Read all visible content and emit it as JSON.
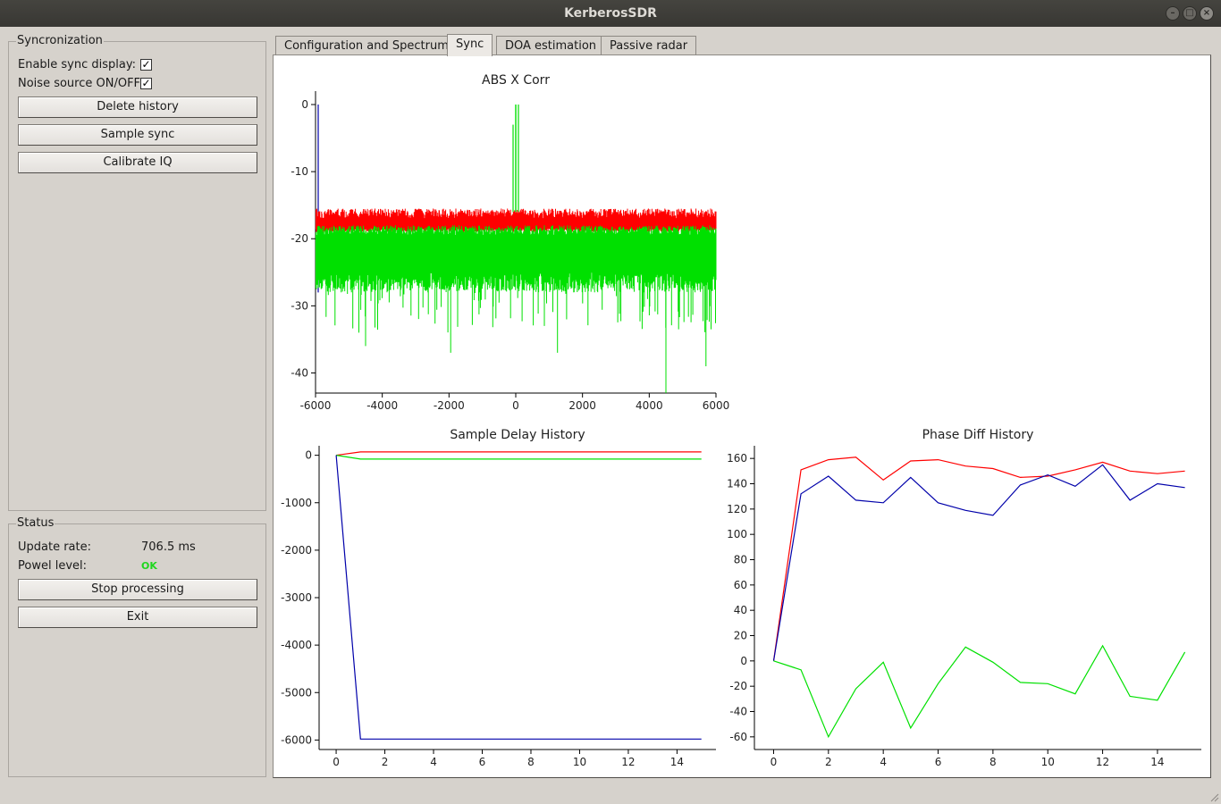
{
  "window": {
    "title": "KerberosSDR"
  },
  "sync_panel": {
    "title": "Syncronization",
    "enable_sync_display": {
      "label": "Enable sync display:",
      "checked": true
    },
    "noise_source": {
      "label": "Noise source ON/OFF",
      "checked": true
    },
    "delete_history_label": "Delete history",
    "sample_sync_label": "Sample sync",
    "calibrate_iq_label": "Calibrate IQ"
  },
  "status_panel": {
    "title": "Status",
    "update_rate_label": "Update rate:",
    "update_rate_value": "706.5 ms",
    "power_level_label": "Powel level:",
    "power_level_value": "OK",
    "stop_processing_label": "Stop processing",
    "exit_label": "Exit"
  },
  "tabs": [
    {
      "label": "Configuration and Spectrum",
      "active": false
    },
    {
      "label": "Sync",
      "active": true
    },
    {
      "label": "DOA estimation",
      "active": false
    },
    {
      "label": "Passive radar",
      "active": false
    }
  ],
  "colors": {
    "red": "#ff0000",
    "green": "#00e000",
    "blue": "#0000aa",
    "ok": "#1fd61f"
  },
  "chart_data": [
    {
      "type": "line",
      "title": "ABS X Corr",
      "xlim": [
        -6000,
        6000
      ],
      "ylim": [
        -43,
        2
      ],
      "xticks": [
        -6000,
        -4000,
        -2000,
        0,
        2000,
        4000,
        6000
      ],
      "yticks": [
        0,
        -10,
        -20,
        -30,
        -40
      ],
      "series": [
        {
          "color": "red",
          "band": [
            -19,
            -15.5
          ]
        },
        {
          "color": "green",
          "band": [
            -25,
            -18
          ],
          "spike_x": 0,
          "spike_y": 0
        },
        {
          "color": "blue",
          "spike_x": -6000,
          "spike_y": 0
        }
      ]
    },
    {
      "type": "line",
      "title": "Sample Delay History",
      "xlim": [
        -0.7,
        15.6
      ],
      "ylim": [
        -6200,
        200
      ],
      "xticks": [
        0,
        2,
        4,
        6,
        8,
        10,
        12,
        14
      ],
      "yticks": [
        0,
        -1000,
        -2000,
        -3000,
        -4000,
        -5000,
        -6000
      ],
      "x": [
        0,
        1,
        2,
        3,
        4,
        5,
        6,
        7,
        8,
        9,
        10,
        11,
        12,
        13,
        14,
        15
      ],
      "series": [
        {
          "color": "red",
          "values": [
            0,
            70,
            70,
            70,
            70,
            70,
            70,
            70,
            70,
            70,
            70,
            70,
            70,
            70,
            70,
            70
          ]
        },
        {
          "color": "green",
          "values": [
            0,
            -80,
            -80,
            -80,
            -80,
            -80,
            -80,
            -80,
            -80,
            -80,
            -80,
            -80,
            -80,
            -80,
            -80,
            -80
          ]
        },
        {
          "color": "blue",
          "values": [
            0,
            -5980,
            -5980,
            -5980,
            -5980,
            -5980,
            -5980,
            -5980,
            -5980,
            -5980,
            -5980,
            -5980,
            -5980,
            -5980,
            -5980,
            -5980
          ]
        }
      ]
    },
    {
      "type": "line",
      "title": "Phase Diff History",
      "xlim": [
        -0.7,
        15.6
      ],
      "ylim": [
        -70,
        170
      ],
      "xticks": [
        0,
        2,
        4,
        6,
        8,
        10,
        12,
        14
      ],
      "yticks": [
        160,
        140,
        120,
        100,
        80,
        60,
        40,
        20,
        0,
        -20,
        -40,
        -60
      ],
      "x": [
        0,
        1,
        2,
        3,
        4,
        5,
        6,
        7,
        8,
        9,
        10,
        11,
        12,
        13,
        14,
        15
      ],
      "series": [
        {
          "color": "red",
          "values": [
            0,
            151,
            159,
            161,
            143,
            158,
            159,
            154,
            152,
            145,
            146,
            151,
            157,
            150,
            148,
            150
          ]
        },
        {
          "color": "blue",
          "values": [
            0,
            132,
            146,
            127,
            125,
            145,
            125,
            119,
            115,
            139,
            147,
            138,
            155,
            127,
            140,
            137
          ]
        },
        {
          "color": "green",
          "values": [
            0,
            -7,
            -60,
            -22,
            -1,
            -53,
            -18,
            11,
            -1,
            -17,
            -18,
            -26,
            12,
            -28,
            -31,
            7
          ]
        }
      ]
    }
  ]
}
